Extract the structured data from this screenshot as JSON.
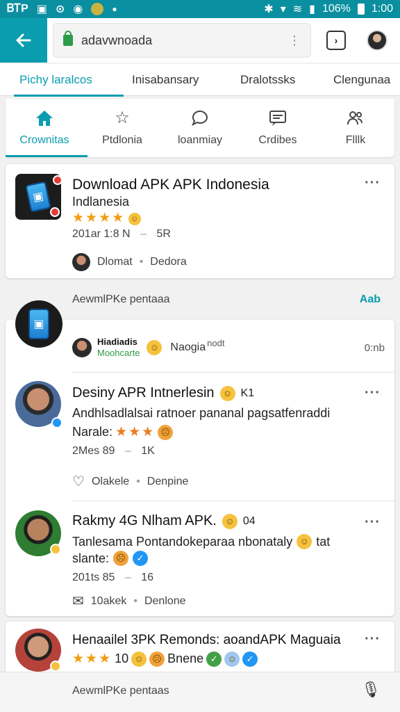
{
  "status_bar": {
    "left_text": "ᏴᎢP",
    "battery": "106%",
    "time": "1:00"
  },
  "browser": {
    "url": "adavwnoada",
    "menu_glyph": "⋮"
  },
  "top_tabs": [
    "Pichy laralcos",
    "Inisabansary",
    "Dralotssks",
    "Clengunaa"
  ],
  "icon_nav": [
    {
      "label": "Crownitas",
      "icon": "home-icon"
    },
    {
      "label": "Ptdlonia",
      "icon": "star-icon"
    },
    {
      "label": "loanmiay",
      "icon": "chat-icon"
    },
    {
      "label": "Crdibes",
      "icon": "message-icon"
    },
    {
      "label": "Flllk",
      "icon": "people-icon"
    }
  ],
  "featured": {
    "title": "Download APK APK Indonesia",
    "subtitle": "Indlanesia",
    "stars": "★★★★",
    "meta_left": "201ar 1:8 N",
    "meta_right": "5R",
    "author": "Dlomat",
    "action": "Dedora"
  },
  "section1": {
    "label": "AewmlPKe pentaaa",
    "link": "Aab"
  },
  "tile": {
    "name_line1": "Hiadiadis",
    "name_line2": "Moohcarte",
    "text": "Naogia",
    "text2": "nodt",
    "right": "0:nb"
  },
  "posts": [
    {
      "title": "Desiny APR Intnerlesin",
      "tag": "K1",
      "body": "Andhlsadlalsai ratnoer pananal pagsatfenraddi",
      "label": "Narale:",
      "stars": "★★★",
      "stat1": "2Mes 89",
      "stat2": "1K",
      "action1": "Olakele",
      "action2": "Denpine"
    },
    {
      "title": "Rakmy 4G Nlham APK.",
      "tag": "04",
      "body": "Tanlesama Pontandokeparaa nbonataly",
      "tag2": "tat",
      "label": "slante:",
      "stat1": "201ts 85",
      "stat2": "16",
      "action1": "10akek",
      "action2": "Denlone"
    },
    {
      "title": "Henaailel 3PK Remonds: aoandAPK Maguaia",
      "stars": "★★★",
      "count": "10",
      "label": "Bnene"
    }
  ],
  "bottom_bar": {
    "label": "AewmlPKe pentaas"
  },
  "colors": {
    "accent": "#0a9db0",
    "star": "#f39c12"
  }
}
